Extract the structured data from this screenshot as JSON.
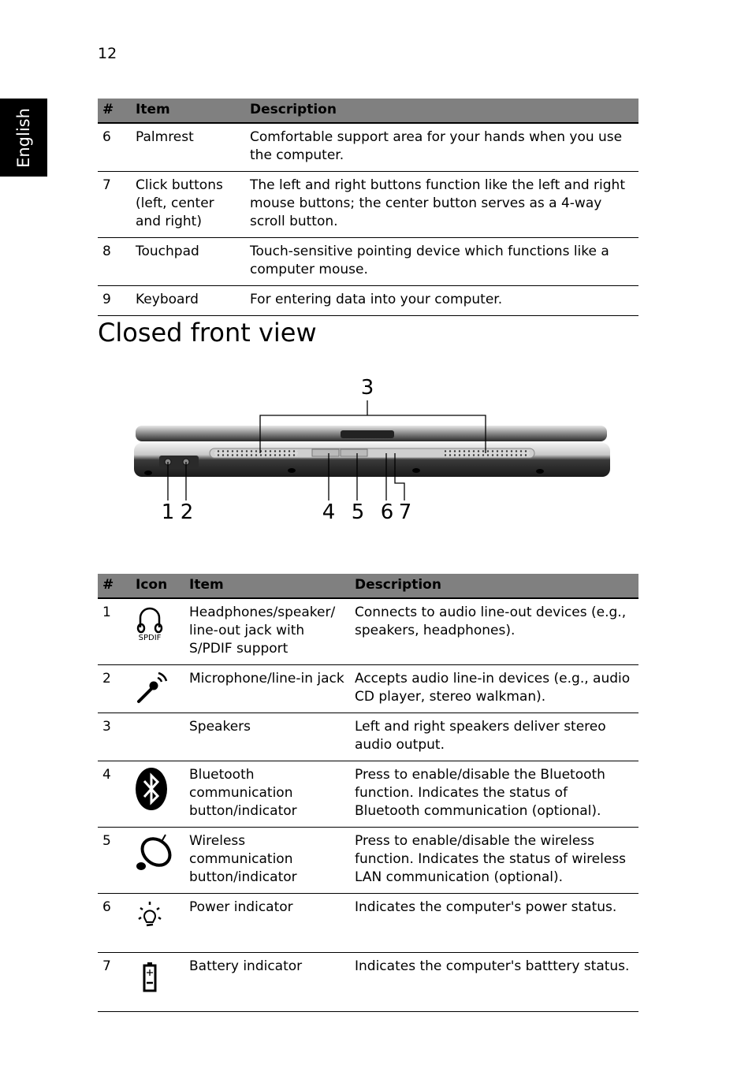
{
  "page": {
    "number": "12",
    "language_tab": "English",
    "section_title": "Closed front view"
  },
  "table_top": {
    "headers": [
      "#",
      "Item",
      "Description"
    ],
    "rows": [
      {
        "num": "6",
        "item": "Palmrest",
        "description": "Comfortable support area for your hands when you use the computer."
      },
      {
        "num": "7",
        "item": "Click buttons (left, center and right)",
        "description": "The left and right buttons function like the left and right mouse buttons; the center button serves as a 4-way scroll button."
      },
      {
        "num": "8",
        "item": "Touchpad",
        "description": "Touch-sensitive pointing device which functions like a computer mouse."
      },
      {
        "num": "9",
        "item": "Keyboard",
        "description": "For entering data into your computer."
      }
    ]
  },
  "figure": {
    "callouts": [
      "1",
      "2",
      "3",
      "4",
      "5",
      "6",
      "7"
    ]
  },
  "table_front": {
    "headers": [
      "#",
      "Icon",
      "Item",
      "Description"
    ],
    "rows": [
      {
        "num": "1",
        "icon": "headphones-spdif-icon",
        "icon_label": "SPDIF",
        "item": "Headphones/speaker/ line-out jack with S/PDIF support",
        "description": "Connects to audio line-out devices (e.g., speakers, headphones)."
      },
      {
        "num": "2",
        "icon": "microphone-icon",
        "item": "Microphone/line-in jack",
        "description": "Accepts audio line-in devices (e.g., audio CD player, stereo walkman)."
      },
      {
        "num": "3",
        "icon": "",
        "item": "Speakers",
        "description": "Left and right speakers deliver stereo audio output."
      },
      {
        "num": "4",
        "icon": "bluetooth-icon",
        "item": "Bluetooth communication button/indicator",
        "description": "Press to enable/disable the Bluetooth function. Indicates the status of Bluetooth communication (optional)."
      },
      {
        "num": "5",
        "icon": "wireless-icon",
        "item": "Wireless communication button/indicator",
        "description": "Press to enable/disable the wireless function. Indicates the status of wireless LAN communication (optional)."
      },
      {
        "num": "6",
        "icon": "power-indicator-icon",
        "item": "Power indicator",
        "description": "Indicates the computer's power status."
      },
      {
        "num": "7",
        "icon": "battery-icon",
        "item": "Battery indicator",
        "description": "Indicates the computer's batttery status."
      }
    ]
  }
}
